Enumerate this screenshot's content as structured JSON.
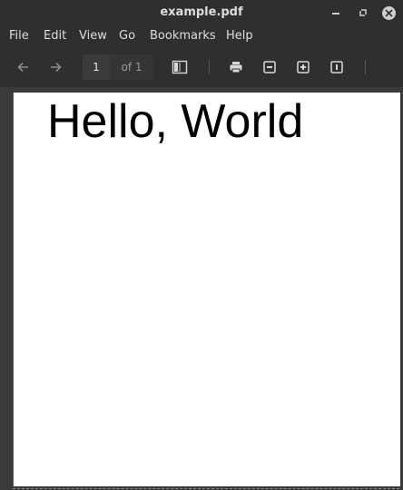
{
  "window": {
    "title": "example.pdf"
  },
  "menu": {
    "items": [
      "File",
      "Edit",
      "View",
      "Go",
      "Bookmarks",
      "Help"
    ]
  },
  "toolbar": {
    "page_current": "1",
    "page_total_label": "of 1"
  },
  "document": {
    "text": "Hello, World"
  },
  "colors": {
    "chrome": "#2f2f2f",
    "page": "#ffffff",
    "text": "#dedede"
  },
  "icons": [
    "back-arrow-icon",
    "forward-arrow-icon",
    "sidebar-toggle-icon",
    "print-icon",
    "zoom-out-icon",
    "zoom-in-icon",
    "zoom-fit-icon"
  ]
}
